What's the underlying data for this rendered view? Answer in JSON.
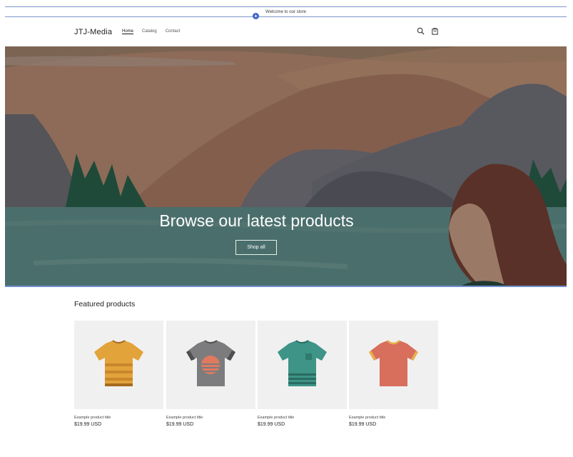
{
  "announcement": "Welcome to our store",
  "header": {
    "logo": "JTJ-Media",
    "nav": [
      "Home",
      "Catalog",
      "Contact"
    ],
    "icons": [
      "search-icon",
      "cart-icon"
    ]
  },
  "hero": {
    "title": "Browse our latest products",
    "button": "Shop all"
  },
  "featured": {
    "title": "Featured products",
    "products": [
      {
        "title": "Example product title",
        "price": "$19.99 USD",
        "color": "#e2a33b"
      },
      {
        "title": "Example product title",
        "price": "$19.99 USD",
        "color": "#7c7c7f"
      },
      {
        "title": "Example product title",
        "price": "$19.99 USD",
        "color": "#3d9487"
      },
      {
        "title": "Example product title",
        "price": "$19.99 USD",
        "color": "#d86e5c"
      }
    ]
  },
  "colors": {
    "accent": "#3b63c9",
    "hero_water": "#4a6e6b",
    "hero_sky": "#8a6a55"
  }
}
